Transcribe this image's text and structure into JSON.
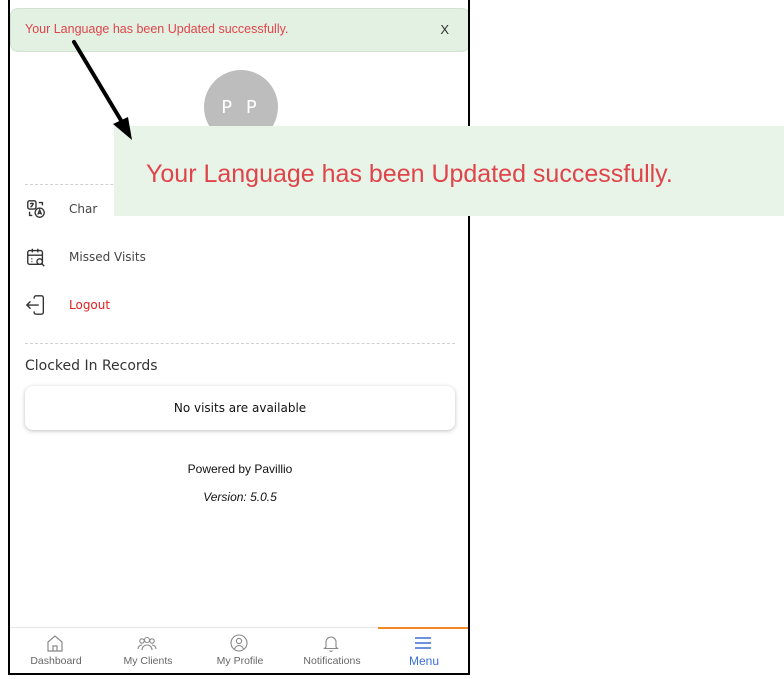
{
  "toast": {
    "message": "Your Language has been Updated successfully.",
    "close_label": "X"
  },
  "profile": {
    "initials": "P P"
  },
  "menu": {
    "items": [
      {
        "label": "Char",
        "icon": "translate-icon",
        "color": "#444444"
      },
      {
        "label": "Missed Visits",
        "icon": "calendar-search-icon",
        "color": "#444444"
      },
      {
        "label": "Logout",
        "icon": "logout-icon",
        "color": "#e0211f"
      }
    ]
  },
  "clocked_in": {
    "title": "Clocked In Records",
    "empty_message": "No visits are available"
  },
  "footer": {
    "powered_by": "Powered by Pavillio",
    "version": "Version: 5.0.5"
  },
  "bottom_nav": {
    "tabs": [
      {
        "label": "Dashboard",
        "icon": "home-icon"
      },
      {
        "label": "My Clients",
        "icon": "clients-icon"
      },
      {
        "label": "My Profile",
        "icon": "profile-icon"
      },
      {
        "label": "Notifications",
        "icon": "bell-icon"
      },
      {
        "label": "Menu",
        "icon": "hamburger-icon",
        "active": true
      }
    ]
  },
  "callout": {
    "message": "Your Language has been Updated successfully."
  },
  "colors": {
    "error_text": "#e0444b",
    "toast_bg": "#e3f1e3",
    "active_tab": "#3b6fd6",
    "active_indicator": "#f08a24",
    "logout": "#e0211f"
  }
}
